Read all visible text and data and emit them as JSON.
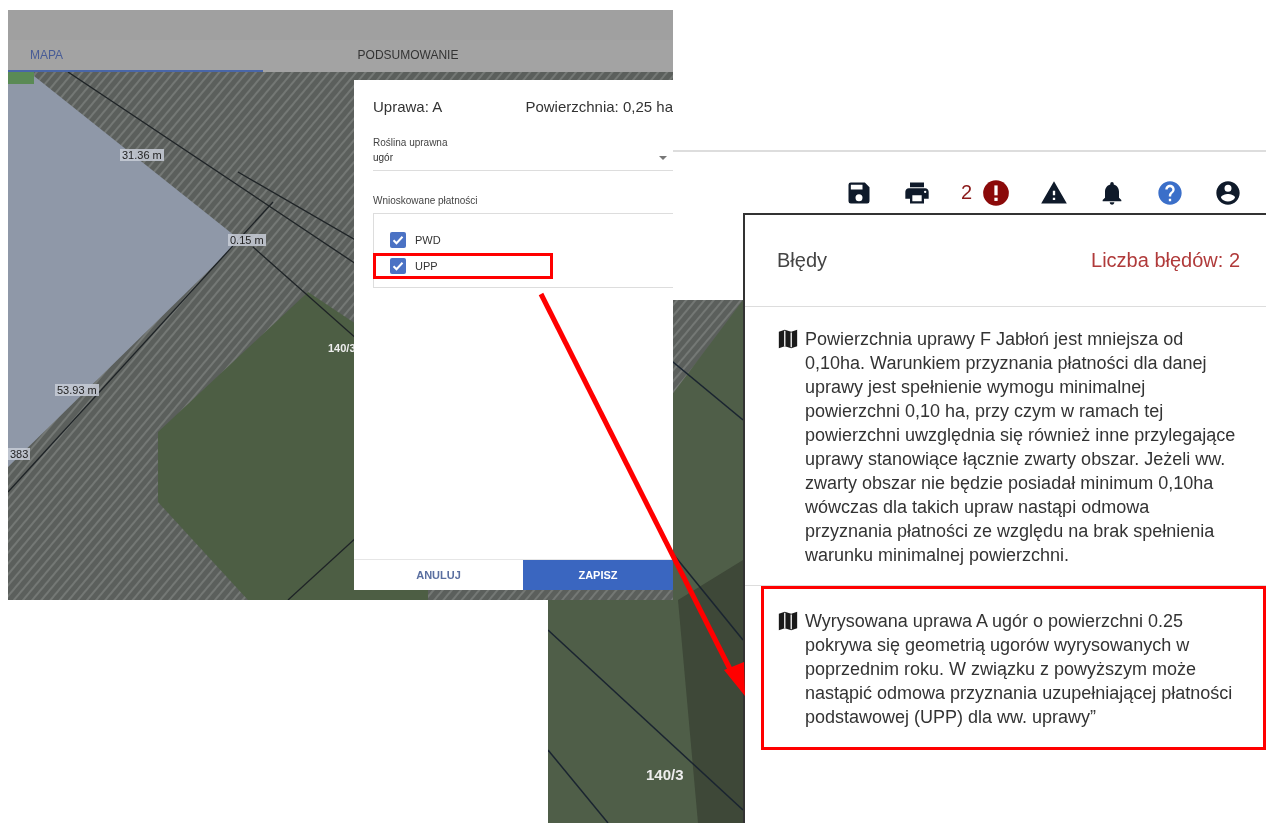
{
  "map_window": {
    "tabs": [
      {
        "label": "MAPA",
        "selected": true
      },
      {
        "label": "PODSUMOWANIE",
        "selected": false
      }
    ],
    "map_labels": [
      "31.36 m",
      "0.15 m",
      "53.93 m",
      "383",
      "140/3"
    ],
    "dialog": {
      "title": "Uprawa: A",
      "area": "Powierzchnia: 0,25 ha",
      "crop_field": {
        "label": "Roślina uprawna",
        "value": "ugór"
      },
      "payments": {
        "label": "Wnioskowane płatności",
        "items": [
          {
            "label": "PWD",
            "checked": true,
            "highlighted": false
          },
          {
            "label": "UPP",
            "checked": true,
            "highlighted": true
          }
        ]
      },
      "buttons": [
        {
          "label": "ANULUJ",
          "kind": "text"
        },
        {
          "label": "ZAPISZ",
          "kind": "primary"
        }
      ]
    }
  },
  "errors_window": {
    "toolbar": {
      "error_count": "2"
    },
    "map_labels": [
      "140/3"
    ],
    "errors_panel": {
      "title": "Błędy",
      "count": "Liczba błędów: 2",
      "errors": [
        {
          "text": "Powierzchnia uprawy F Jabłoń jest mniejsza od 0,10ha. Warunkiem przyznania płatności dla danej uprawy jest spełnienie wymogu minimalnej powierzchni 0,10 ha, przy czym w ramach tej powierzchni uwzględnia się również inne przylegające uprawy stanowiące łącznie zwarty obszar. Jeżeli ww. zwarty obszar nie będzie posiadał minimum 0,10ha wówczas dla takich upraw nastąpi odmowa przyznania płatności ze względu na brak spełnienia warunku minimalnej powierzchni.",
          "highlighted": false
        },
        {
          "text": "Wyrysowana uprawa A ugór o powierzchni 0.25 pokrywa się geometrią ugorów wyrysowanych w poprzednim roku. W związku z powyższym może nastąpić odmowa przyznania uzupełniającej płatności podstawowej (UPP) dla ww. uprawy”",
          "highlighted": true
        }
      ]
    }
  }
}
